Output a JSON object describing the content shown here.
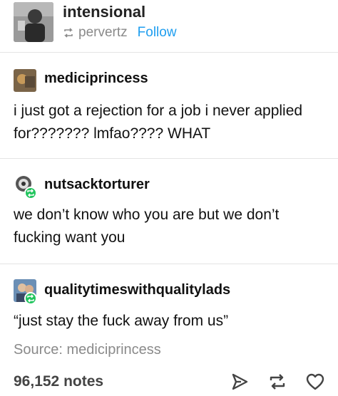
{
  "header": {
    "username": "intensional",
    "reblogged_from": "pervertz",
    "follow_label": "Follow"
  },
  "posts": [
    {
      "username": "mediciprincess",
      "text": "i just got a rejection for a job i never applied for??????? lmfao???? WHAT"
    },
    {
      "username": "nutsacktorturer",
      "text": "we don’t know who you are but we don’t fucking want you"
    },
    {
      "username": "qualitytimeswithqualitylads",
      "text": "“just stay the fuck away from us”"
    }
  ],
  "source": {
    "label": "Source:",
    "name": "mediciprincess"
  },
  "footer": {
    "notes": "96,152 notes",
    "icons": [
      "share-icon",
      "reblog-icon",
      "heart-icon"
    ]
  },
  "colors": {
    "accent": "#1f9eef",
    "muted": "#8a8a8a",
    "badge": "#22c55e",
    "divider": "#e4e4e4"
  }
}
